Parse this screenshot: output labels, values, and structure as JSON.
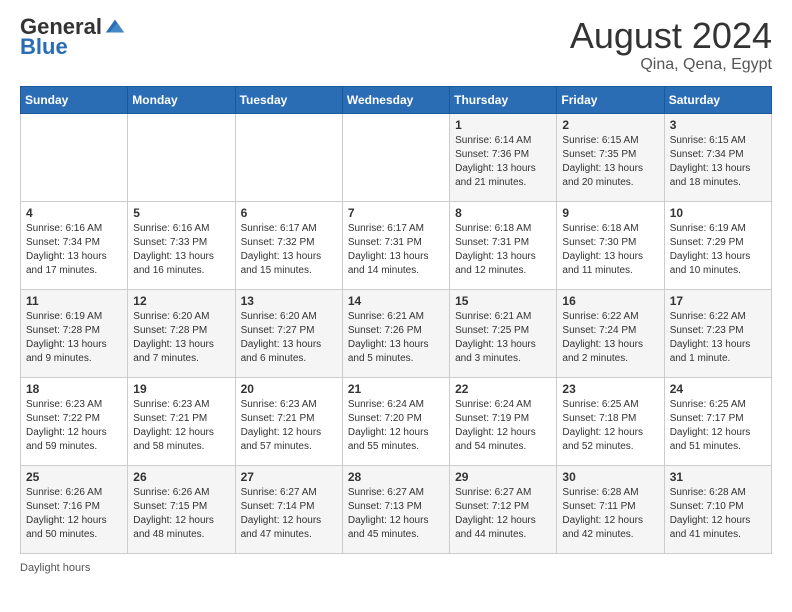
{
  "header": {
    "logo_general": "General",
    "logo_blue": "Blue",
    "month": "August 2024",
    "location": "Qina, Qena, Egypt"
  },
  "weekdays": [
    "Sunday",
    "Monday",
    "Tuesday",
    "Wednesday",
    "Thursday",
    "Friday",
    "Saturday"
  ],
  "footer": {
    "daylight_label": "Daylight hours"
  },
  "weeks": [
    [
      {
        "day": "",
        "info": ""
      },
      {
        "day": "",
        "info": ""
      },
      {
        "day": "",
        "info": ""
      },
      {
        "day": "",
        "info": ""
      },
      {
        "day": "1",
        "info": "Sunrise: 6:14 AM\nSunset: 7:36 PM\nDaylight: 13 hours and 21 minutes."
      },
      {
        "day": "2",
        "info": "Sunrise: 6:15 AM\nSunset: 7:35 PM\nDaylight: 13 hours and 20 minutes."
      },
      {
        "day": "3",
        "info": "Sunrise: 6:15 AM\nSunset: 7:34 PM\nDaylight: 13 hours and 18 minutes."
      }
    ],
    [
      {
        "day": "4",
        "info": "Sunrise: 6:16 AM\nSunset: 7:34 PM\nDaylight: 13 hours and 17 minutes."
      },
      {
        "day": "5",
        "info": "Sunrise: 6:16 AM\nSunset: 7:33 PM\nDaylight: 13 hours and 16 minutes."
      },
      {
        "day": "6",
        "info": "Sunrise: 6:17 AM\nSunset: 7:32 PM\nDaylight: 13 hours and 15 minutes."
      },
      {
        "day": "7",
        "info": "Sunrise: 6:17 AM\nSunset: 7:31 PM\nDaylight: 13 hours and 14 minutes."
      },
      {
        "day": "8",
        "info": "Sunrise: 6:18 AM\nSunset: 7:31 PM\nDaylight: 13 hours and 12 minutes."
      },
      {
        "day": "9",
        "info": "Sunrise: 6:18 AM\nSunset: 7:30 PM\nDaylight: 13 hours and 11 minutes."
      },
      {
        "day": "10",
        "info": "Sunrise: 6:19 AM\nSunset: 7:29 PM\nDaylight: 13 hours and 10 minutes."
      }
    ],
    [
      {
        "day": "11",
        "info": "Sunrise: 6:19 AM\nSunset: 7:28 PM\nDaylight: 13 hours and 9 minutes."
      },
      {
        "day": "12",
        "info": "Sunrise: 6:20 AM\nSunset: 7:28 PM\nDaylight: 13 hours and 7 minutes."
      },
      {
        "day": "13",
        "info": "Sunrise: 6:20 AM\nSunset: 7:27 PM\nDaylight: 13 hours and 6 minutes."
      },
      {
        "day": "14",
        "info": "Sunrise: 6:21 AM\nSunset: 7:26 PM\nDaylight: 13 hours and 5 minutes."
      },
      {
        "day": "15",
        "info": "Sunrise: 6:21 AM\nSunset: 7:25 PM\nDaylight: 13 hours and 3 minutes."
      },
      {
        "day": "16",
        "info": "Sunrise: 6:22 AM\nSunset: 7:24 PM\nDaylight: 13 hours and 2 minutes."
      },
      {
        "day": "17",
        "info": "Sunrise: 6:22 AM\nSunset: 7:23 PM\nDaylight: 13 hours and 1 minute."
      }
    ],
    [
      {
        "day": "18",
        "info": "Sunrise: 6:23 AM\nSunset: 7:22 PM\nDaylight: 12 hours and 59 minutes."
      },
      {
        "day": "19",
        "info": "Sunrise: 6:23 AM\nSunset: 7:21 PM\nDaylight: 12 hours and 58 minutes."
      },
      {
        "day": "20",
        "info": "Sunrise: 6:23 AM\nSunset: 7:21 PM\nDaylight: 12 hours and 57 minutes."
      },
      {
        "day": "21",
        "info": "Sunrise: 6:24 AM\nSunset: 7:20 PM\nDaylight: 12 hours and 55 minutes."
      },
      {
        "day": "22",
        "info": "Sunrise: 6:24 AM\nSunset: 7:19 PM\nDaylight: 12 hours and 54 minutes."
      },
      {
        "day": "23",
        "info": "Sunrise: 6:25 AM\nSunset: 7:18 PM\nDaylight: 12 hours and 52 minutes."
      },
      {
        "day": "24",
        "info": "Sunrise: 6:25 AM\nSunset: 7:17 PM\nDaylight: 12 hours and 51 minutes."
      }
    ],
    [
      {
        "day": "25",
        "info": "Sunrise: 6:26 AM\nSunset: 7:16 PM\nDaylight: 12 hours and 50 minutes."
      },
      {
        "day": "26",
        "info": "Sunrise: 6:26 AM\nSunset: 7:15 PM\nDaylight: 12 hours and 48 minutes."
      },
      {
        "day": "27",
        "info": "Sunrise: 6:27 AM\nSunset: 7:14 PM\nDaylight: 12 hours and 47 minutes."
      },
      {
        "day": "28",
        "info": "Sunrise: 6:27 AM\nSunset: 7:13 PM\nDaylight: 12 hours and 45 minutes."
      },
      {
        "day": "29",
        "info": "Sunrise: 6:27 AM\nSunset: 7:12 PM\nDaylight: 12 hours and 44 minutes."
      },
      {
        "day": "30",
        "info": "Sunrise: 6:28 AM\nSunset: 7:11 PM\nDaylight: 12 hours and 42 minutes."
      },
      {
        "day": "31",
        "info": "Sunrise: 6:28 AM\nSunset: 7:10 PM\nDaylight: 12 hours and 41 minutes."
      }
    ]
  ]
}
